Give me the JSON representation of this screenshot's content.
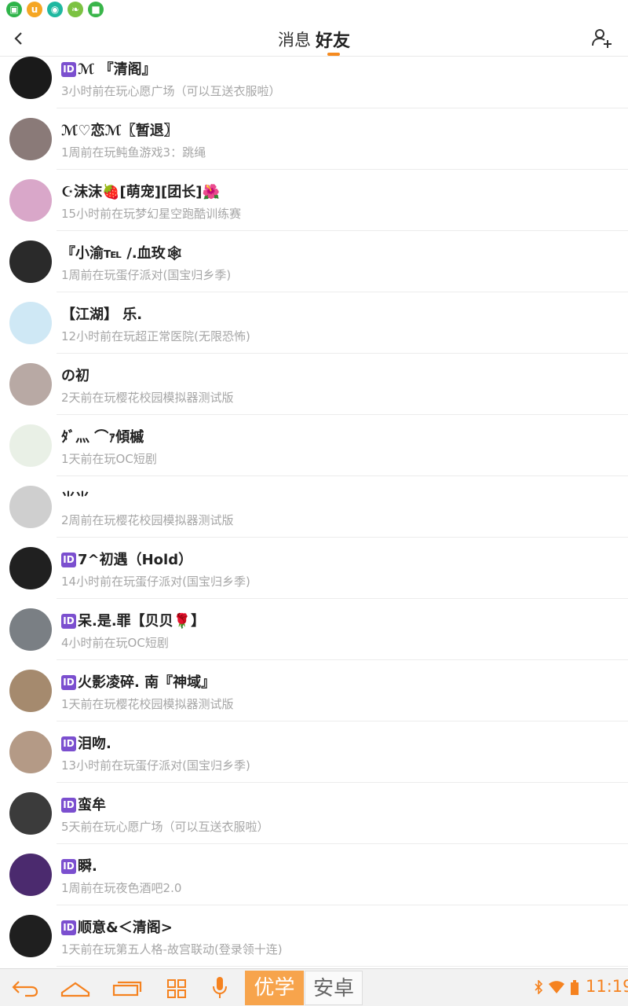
{
  "header": {
    "tab_messages": "消息",
    "tab_friends": "好友"
  },
  "friends": [
    {
      "name": "ℳ 『清阁』",
      "badge": "ID",
      "status": "3小时前在玩心愿广场（可以互送衣服啦）",
      "avatar_color": "#1a1a1a"
    },
    {
      "name": "ℳ♡恋ℳ〖暂退〗",
      "badge": "",
      "status": "1周前在玩鲀鱼游戏3：跳绳",
      "avatar_color": "#8a7a78"
    },
    {
      "name": "☪沫沫🍓[萌宠][团长]🌺",
      "badge": "",
      "status": "15小时前在玩梦幻星空跑酷训练赛",
      "avatar_color": "#d9a7c9"
    },
    {
      "name": "『小渝℡ /.血玫🕸",
      "badge": "",
      "status": "1周前在玩蛋仔派对(国宝归乡季)",
      "avatar_color": "#2a2a2a"
    },
    {
      "name": "【江湖】 乐.",
      "badge": "",
      "status": "12小时前在玩超正常医院(无限恐怖)",
      "avatar_color": "#cfe8f5"
    },
    {
      "name": "の初",
      "badge": "",
      "status": "2天前在玩樱花校园模拟器测试版",
      "avatar_color": "#b8a9a4"
    },
    {
      "name": "ﾀﾞ灬 ⌒ｧ傾槭",
      "badge": "",
      "status": "1天前在玩OC短剧",
      "avatar_color": "#e9f0e6"
    },
    {
      "name": "⺌⺌",
      "badge": "",
      "status": "2周前在玩樱花校园模拟器测试版",
      "avatar_color": "#cfcfcf"
    },
    {
      "name": "7^初遇（Hold）",
      "badge": "ID",
      "status": "14小时前在玩蛋仔派对(国宝归乡季)",
      "avatar_color": "#202020"
    },
    {
      "name": "呆.是.罪【贝贝🌹】",
      "badge": "ID",
      "status": "4小时前在玩OC短剧",
      "avatar_color": "#7a7f84"
    },
    {
      "name": "火影凌碎. 南『神域』",
      "badge": "ID",
      "status": "1天前在玩樱花校园模拟器测试版",
      "avatar_color": "#a58a6e"
    },
    {
      "name": "泪吻.",
      "badge": "ID",
      "status": "13小时前在玩蛋仔派对(国宝归乡季)",
      "avatar_color": "#b49a86"
    },
    {
      "name": "蛮牟",
      "badge": "ID",
      "status": "5天前在玩心愿广场（可以互送衣服啦）",
      "avatar_color": "#3b3b3b"
    },
    {
      "name": "瞬.",
      "badge": "ID",
      "status": "1周前在玩夜色酒吧2.0",
      "avatar_color": "#4b2a6e"
    },
    {
      "name": "顺意&＜清阁>",
      "badge": "ID",
      "status": "1天前在玩第五人格-故宫联动(登录领十连)",
      "avatar_color": "#1f1f1f"
    }
  ],
  "navbar": {
    "youxue": "优学",
    "anzhuo": "安卓",
    "time": "11:19"
  },
  "colors": {
    "accent": "#f58a1f",
    "badge": "#7b4fcf"
  }
}
